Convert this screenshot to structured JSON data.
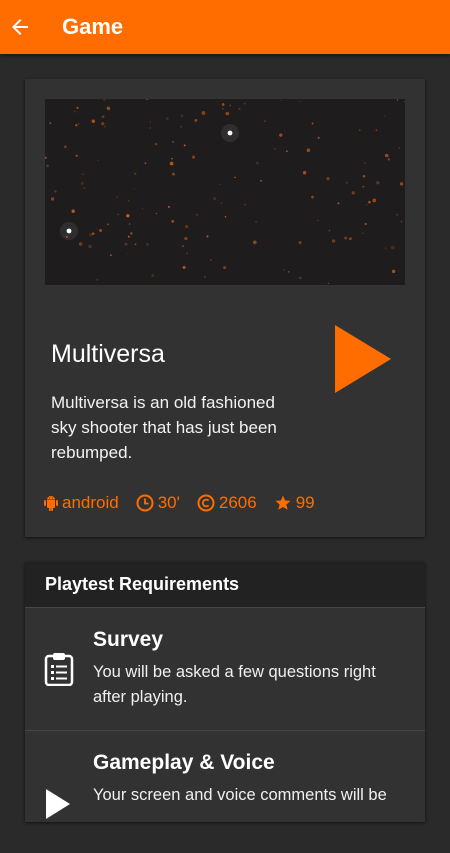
{
  "appbar": {
    "title": "Game",
    "back_icon": "arrow-left-icon",
    "color": "#ff6d00"
  },
  "game": {
    "title": "Multiversa",
    "description": "Multiversa is an old fashioned sky shooter that has just been rebumped.",
    "platform": "android",
    "duration": "30'",
    "plays": "2606",
    "rating": "99",
    "accent": "#ff6d00"
  },
  "requirements": {
    "header": "Playtest Requirements",
    "items": [
      {
        "title": "Survey",
        "description": "You will be asked a few questions right after playing.",
        "icon": "clipboard-icon"
      },
      {
        "title": "Gameplay & Voice",
        "description": "Your screen and voice comments will be",
        "icon": "play-icon"
      }
    ]
  }
}
